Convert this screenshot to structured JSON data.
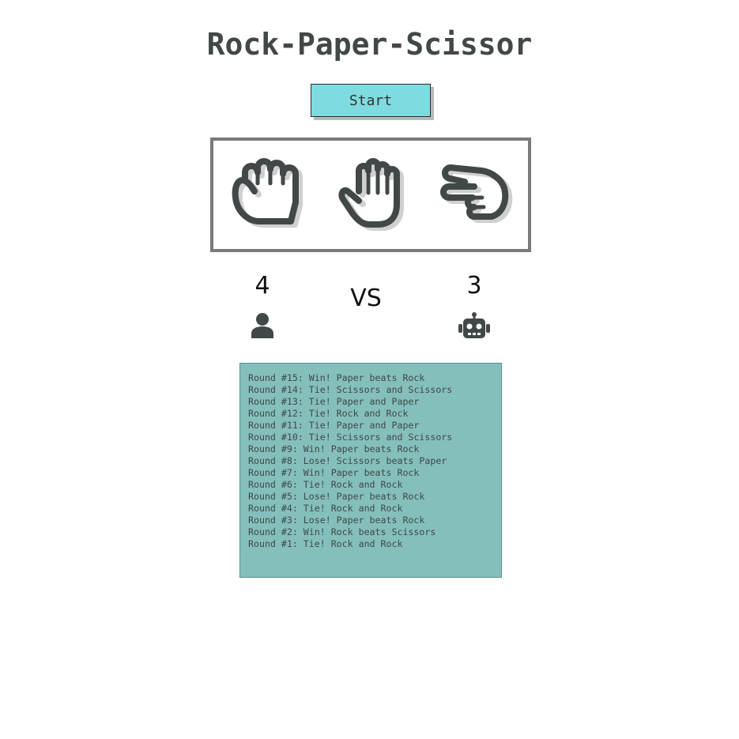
{
  "header": {
    "title": "Rock-Paper-Scissor"
  },
  "controls": {
    "start_label": "Start"
  },
  "choices": [
    {
      "name": "rock",
      "icon": "fist-icon"
    },
    {
      "name": "paper",
      "icon": "open-hand-icon"
    },
    {
      "name": "scissors",
      "icon": "scissors-hand-icon"
    }
  ],
  "scoreboard": {
    "player_score": "4",
    "vs_label": "VS",
    "computer_score": "3",
    "player_icon": "user-icon",
    "computer_icon": "robot-icon"
  },
  "log": [
    "Round #15: Win! Paper beats Rock",
    "Round #14: Tie! Scissors and Scissors",
    "Round #13: Tie! Paper and Paper",
    "Round #12: Tie! Rock and Rock",
    "Round #11: Tie! Paper and Paper",
    "Round #10: Tie! Scissors and Scissors",
    "Round #9: Win! Paper beats Rock",
    "Round #8: Lose! Scissors beats Paper",
    "Round #7: Win! Paper beats Rock",
    "Round #6: Tie! Rock and Rock",
    "Round #5: Lose! Paper beats Rock",
    "Round #4: Tie! Rock and Rock",
    "Round #3: Lose! Paper beats Rock",
    "Round #2: Win! Rock beats Scissors",
    "Round #1: Tie! Rock and Rock"
  ],
  "colors": {
    "accent_button": "#7edbdf",
    "log_background": "#84bfbc",
    "icon_dark": "#424847",
    "icon_shadow": "#d0d0d0"
  }
}
